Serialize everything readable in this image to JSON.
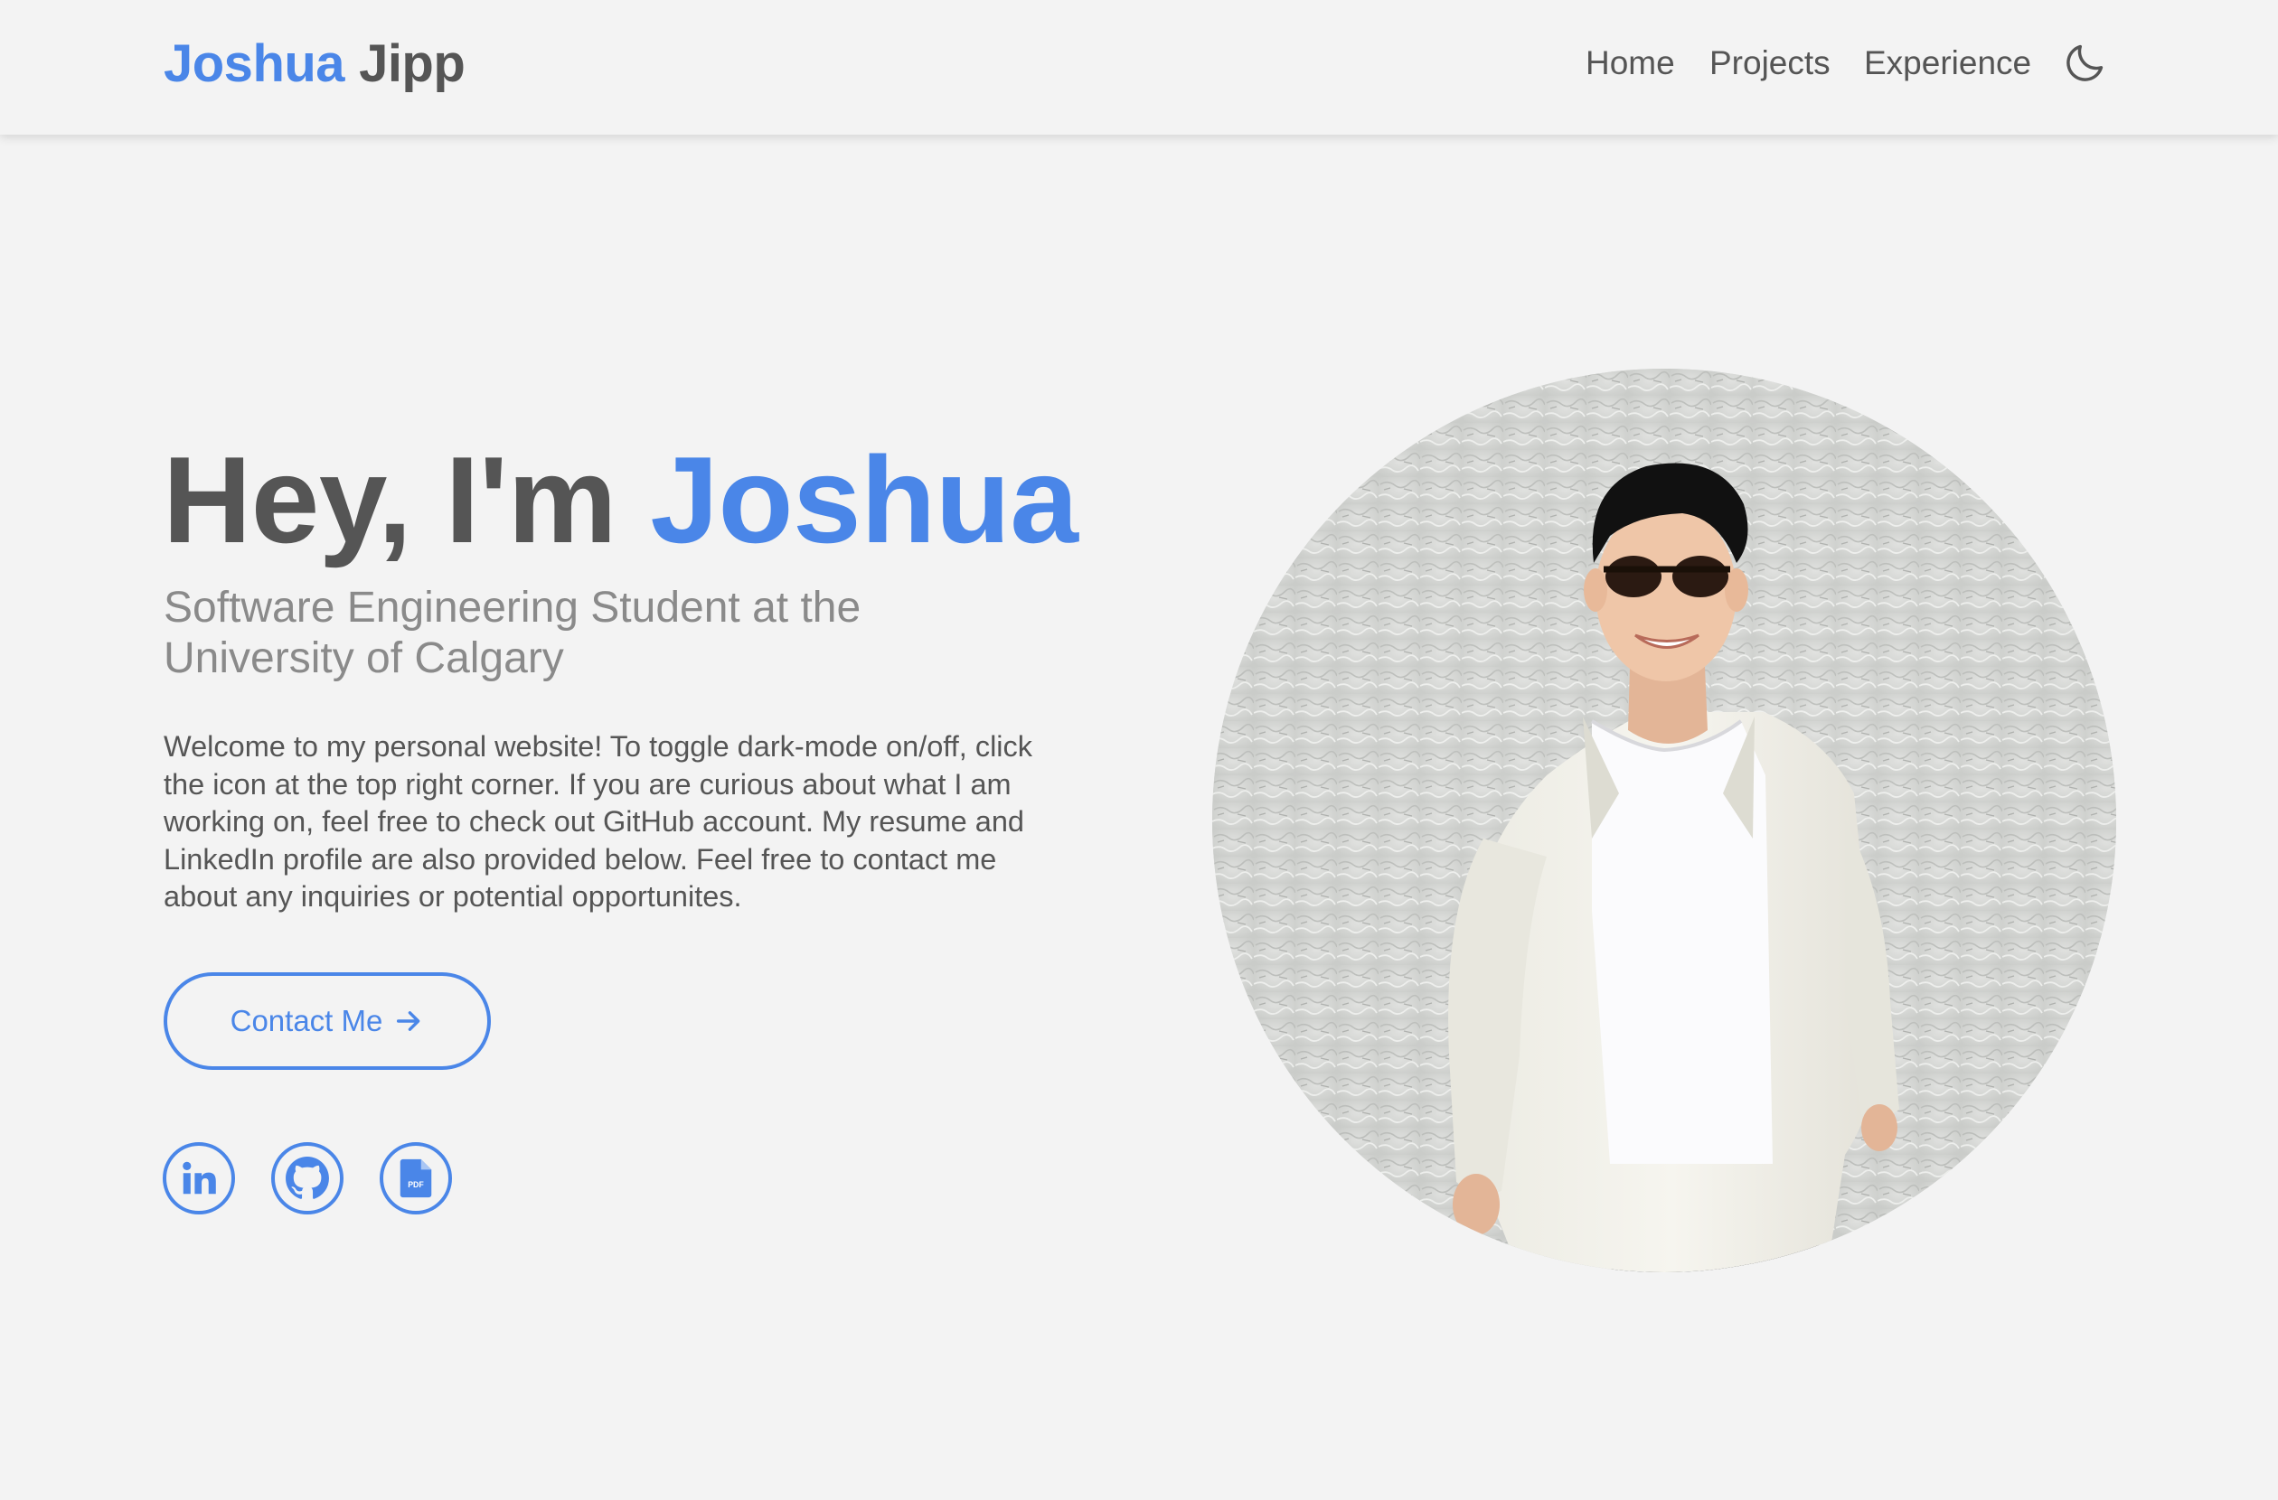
{
  "header": {
    "brand_first": "Joshua",
    "brand_last": "Jipp",
    "nav": {
      "home": "Home",
      "projects": "Projects",
      "experience": "Experience"
    },
    "theme_toggle_icon": "moon-icon"
  },
  "hero": {
    "title_prefix": "Hey, I'm",
    "title_name": "Joshua",
    "subtitle_line1": "Software Engineering Student at the",
    "subtitle_line2": "University of Calgary",
    "intro": "Welcome to my personal website! To toggle dark-mode on/off, click the icon at the top right corner. If you are curious about what I am working on, feel free to check out GitHub account. My resume and LinkedIn profile are also provided below. Feel free to contact me about any inquiries or potential opportunites.",
    "contact_label": "Contact Me",
    "contact_icon": "arrow-right-icon"
  },
  "social": {
    "linkedin_icon": "linkedin-icon",
    "github_icon": "github-icon",
    "resume_icon": "pdf-file-icon",
    "resume_badge": "PDF"
  },
  "colors": {
    "accent": "#4a86e8",
    "text": "#555555",
    "muted": "#8a8a8a",
    "background": "#f3f3f3"
  }
}
